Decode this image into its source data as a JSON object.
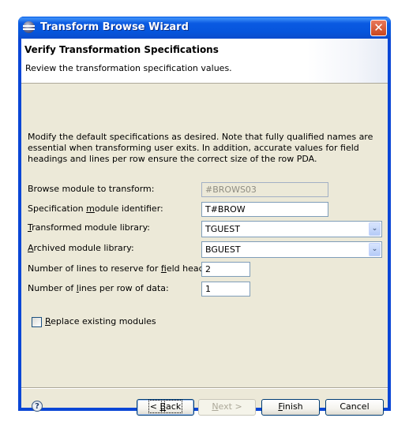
{
  "window": {
    "title": "Transform Browse Wizard",
    "close_label": "✕"
  },
  "header": {
    "title": "Verify Transformation Specifications",
    "description": "Review the transformation specification values."
  },
  "intro_text": "Modify the default specifications as desired.  Note that fully qualified names are essential when transforming user exits.  In addition, accurate values for field headings and lines per row ensure the correct size of the row PDA.",
  "form": {
    "browse_module": {
      "label": "Browse module to transform:",
      "value": "#BROWS03"
    },
    "spec_module": {
      "label_pre": "Specification ",
      "label_mn": "m",
      "label_post": "odule identifier:",
      "value": "T#BROW"
    },
    "transformed_lib": {
      "label_mn": "T",
      "label_post": "ransformed module library:",
      "value": "TGUEST"
    },
    "archived_lib": {
      "label_mn": "A",
      "label_post": "rchived module library:",
      "value": "BGUEST"
    },
    "field_heading_lines": {
      "label_pre": "Number of lines to reserve for ",
      "label_mn": "f",
      "label_post": "ield heading:",
      "value": "2"
    },
    "lines_per_row": {
      "label_pre": "Number of ",
      "label_mn": "l",
      "label_post": "ines per row of data:",
      "value": "1"
    },
    "replace_existing": {
      "label_mn": "R",
      "label_post": "eplace existing modules",
      "checked": false
    }
  },
  "footer": {
    "help_glyph": "?",
    "back": {
      "pre": "< ",
      "mn": "B",
      "post": "ack"
    },
    "next": {
      "mn": "N",
      "post": "ext >"
    },
    "finish": {
      "mn": "F",
      "post": "inish"
    },
    "cancel": "Cancel"
  },
  "colors": {
    "titlebar": "#0a5ae2",
    "client_bg": "#ece9d8",
    "field_border": "#7f9db9"
  }
}
